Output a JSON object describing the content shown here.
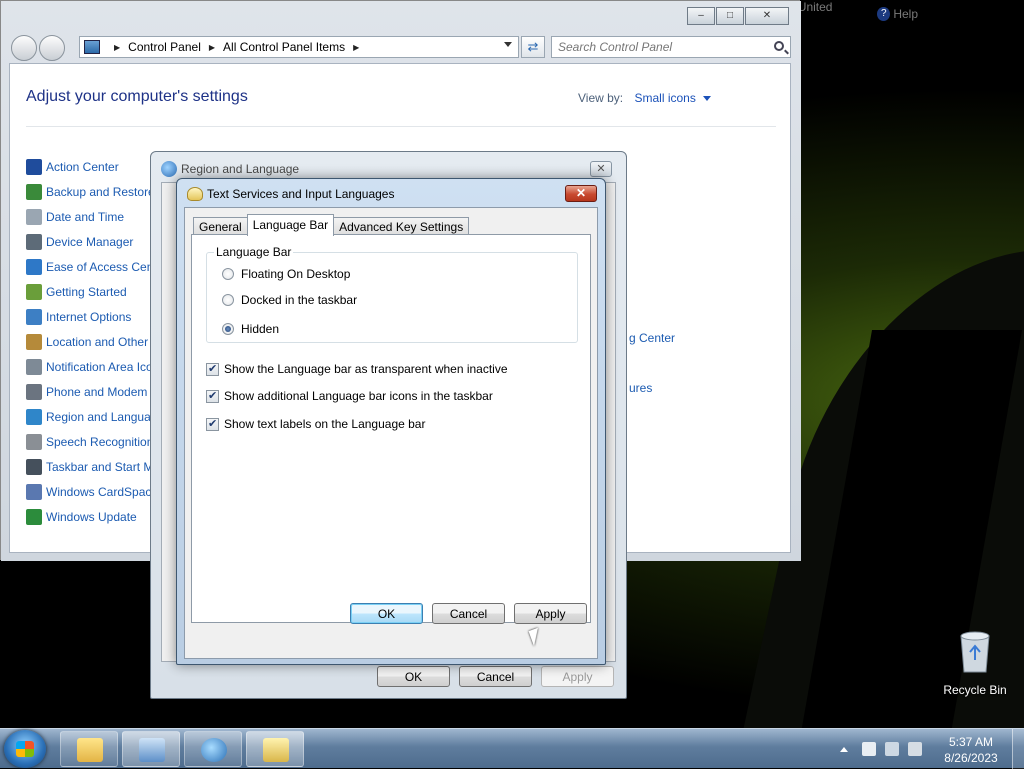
{
  "language_bar": {
    "language": "EN English (United States)",
    "help": "Help"
  },
  "control_panel": {
    "breadcrumb": [
      "Control Panel",
      "All Control Panel Items"
    ],
    "search_placeholder": "Search Control Panel",
    "heading": "Adjust your computer's settings",
    "view_by_label": "View by:",
    "view_by_value": "Small icons",
    "items": [
      {
        "label": "Action Center",
        "icon": "flag-icon",
        "color": "#1f4c9c"
      },
      {
        "label": "Backup and Restore",
        "icon": "backup-icon",
        "color": "#3a8a3a"
      },
      {
        "label": "Date and Time",
        "icon": "clock-icon",
        "color": "#9aa6b2"
      },
      {
        "label": "Device Manager",
        "icon": "device-manager-icon",
        "color": "#5d6b78"
      },
      {
        "label": "Ease of Access Cent",
        "icon": "ease-of-access-icon",
        "color": "#2e78c7"
      },
      {
        "label": "Getting Started",
        "icon": "getting-started-icon",
        "color": "#6a9e3a"
      },
      {
        "label": "Internet Options",
        "icon": "internet-options-icon",
        "color": "#3d7fc4"
      },
      {
        "label": "Location and Other",
        "icon": "location-icon",
        "color": "#b58a3a"
      },
      {
        "label": "Notification Area Ico",
        "icon": "notification-area-icon",
        "color": "#7e8a96"
      },
      {
        "label": "Phone and Modem",
        "icon": "phone-icon",
        "color": "#6b7480"
      },
      {
        "label": "Region and Languag",
        "icon": "globe-icon",
        "color": "#2f86c9"
      },
      {
        "label": "Speech Recognition",
        "icon": "microphone-icon",
        "color": "#8a8f95"
      },
      {
        "label": "Taskbar and Start M",
        "icon": "taskbar-icon",
        "color": "#45505c"
      },
      {
        "label": "Windows CardSpace",
        "icon": "cardspace-icon",
        "color": "#5a78b0"
      },
      {
        "label": "Windows Update",
        "icon": "windows-update-icon",
        "color": "#2c8c3c"
      }
    ],
    "right_column": [
      "g Center",
      "ures"
    ]
  },
  "region_dialog": {
    "title": "Region and Language",
    "ok": "OK",
    "cancel": "Cancel",
    "apply": "Apply"
  },
  "text_services_dialog": {
    "title": "Text Services and Input Languages",
    "tabs": [
      "General",
      "Language Bar",
      "Advanced Key Settings"
    ],
    "active_tab": "Language Bar",
    "group_label": "Language Bar",
    "radios": [
      {
        "label": "Floating On Desktop",
        "selected": false
      },
      {
        "label": "Docked in the taskbar",
        "selected": false
      },
      {
        "label": "Hidden",
        "selected": true
      }
    ],
    "checkboxes": [
      {
        "label": "Show the Language bar as transparent when inactive",
        "checked": true
      },
      {
        "label": "Show additional Language bar icons in the taskbar",
        "checked": true
      },
      {
        "label": "Show text labels on the Language bar",
        "checked": true
      }
    ],
    "ok": "OK",
    "cancel": "Cancel",
    "apply": "Apply"
  },
  "desktop": {
    "recycle_bin": "Recycle Bin"
  },
  "taskbar": {
    "time": "5:37 AM",
    "date": "8/26/2023"
  }
}
